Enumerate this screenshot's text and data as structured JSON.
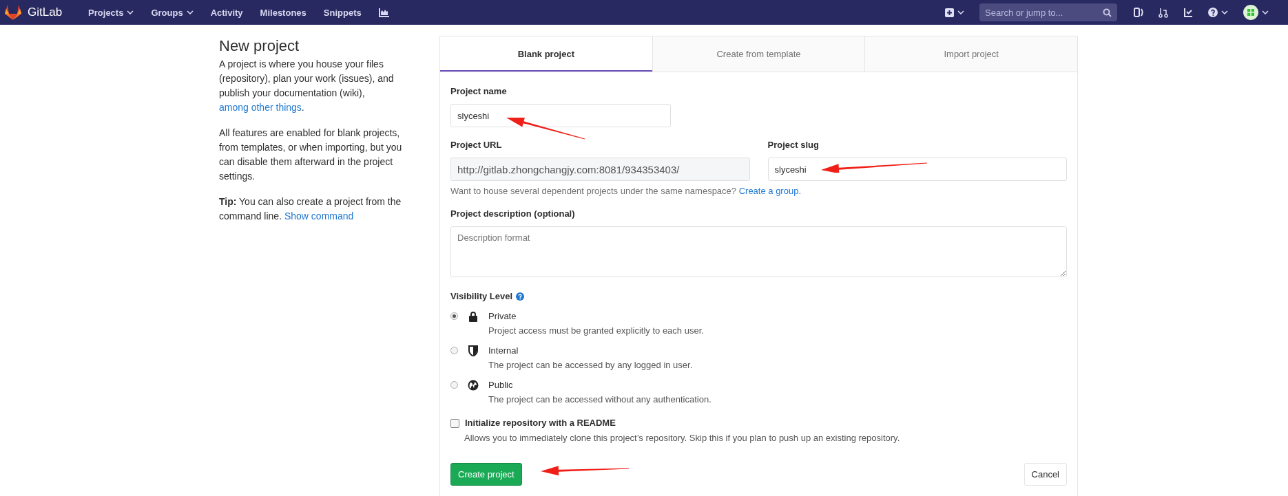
{
  "navbar": {
    "brand": "GitLab",
    "items": [
      {
        "label": "Projects",
        "dropdown": true
      },
      {
        "label": "Groups",
        "dropdown": true
      },
      {
        "label": "Activity",
        "dropdown": false
      },
      {
        "label": "Milestones",
        "dropdown": false
      },
      {
        "label": "Snippets",
        "dropdown": false
      }
    ],
    "search": {
      "placeholder": "Search or jump to..."
    }
  },
  "sidebar": {
    "title": "New project",
    "intro": "A project is where you house your files (repository), plan your work (issues), and publish your documentation (wiki), ",
    "intro_link": "among other things",
    "intro_end": ".",
    "features": "All features are enabled for blank projects, from templates, or when importing, but you can disable them afterward in the project settings.",
    "tip": "**Tip:** You can also create a project from the command line. ",
    "tip_link": "Show command"
  },
  "tabs": [
    {
      "label": "Blank project",
      "selected": true
    },
    {
      "label": "Create from template",
      "selected": false
    },
    {
      "label": "Import project",
      "selected": false
    }
  ],
  "form": {
    "project_name": {
      "label": "Project name",
      "value": "slyceshi",
      "arrow": true
    },
    "project_url": {
      "label": "Project URL",
      "value": "http://gitlab.zhongchangjy.com:8081/934353403/"
    },
    "project_slug": {
      "label": "Project slug",
      "value": "slyceshi",
      "arrow": true
    },
    "namespace_help": "Want to house several dependent projects under the same namespace? ",
    "namespace_link": "Create a group.",
    "description": {
      "label": "Project description (optional)",
      "placeholder": "Description format"
    },
    "visibility": {
      "label": "Visibility Level",
      "options": [
        {
          "kind": "lock",
          "label": "Private",
          "description": "Project access must be granted explicitly to each user.",
          "selected": true
        },
        {
          "kind": "shield",
          "label": "Internal",
          "description": "The project can be accessed by any logged in user.",
          "selected": false
        },
        {
          "kind": "globe",
          "label": "Public",
          "description": "The project can be accessed without any authentication.",
          "selected": false
        }
      ]
    },
    "readme": {
      "label": "Initialize repository with a README",
      "description": "Allows you to immediately clone this project’s repository. Skip this if you plan to push up an existing repository.",
      "checked": false
    },
    "create_button": {
      "label": "Create project",
      "arrow": true
    },
    "cancel_button": {
      "label": "Cancel"
    }
  }
}
